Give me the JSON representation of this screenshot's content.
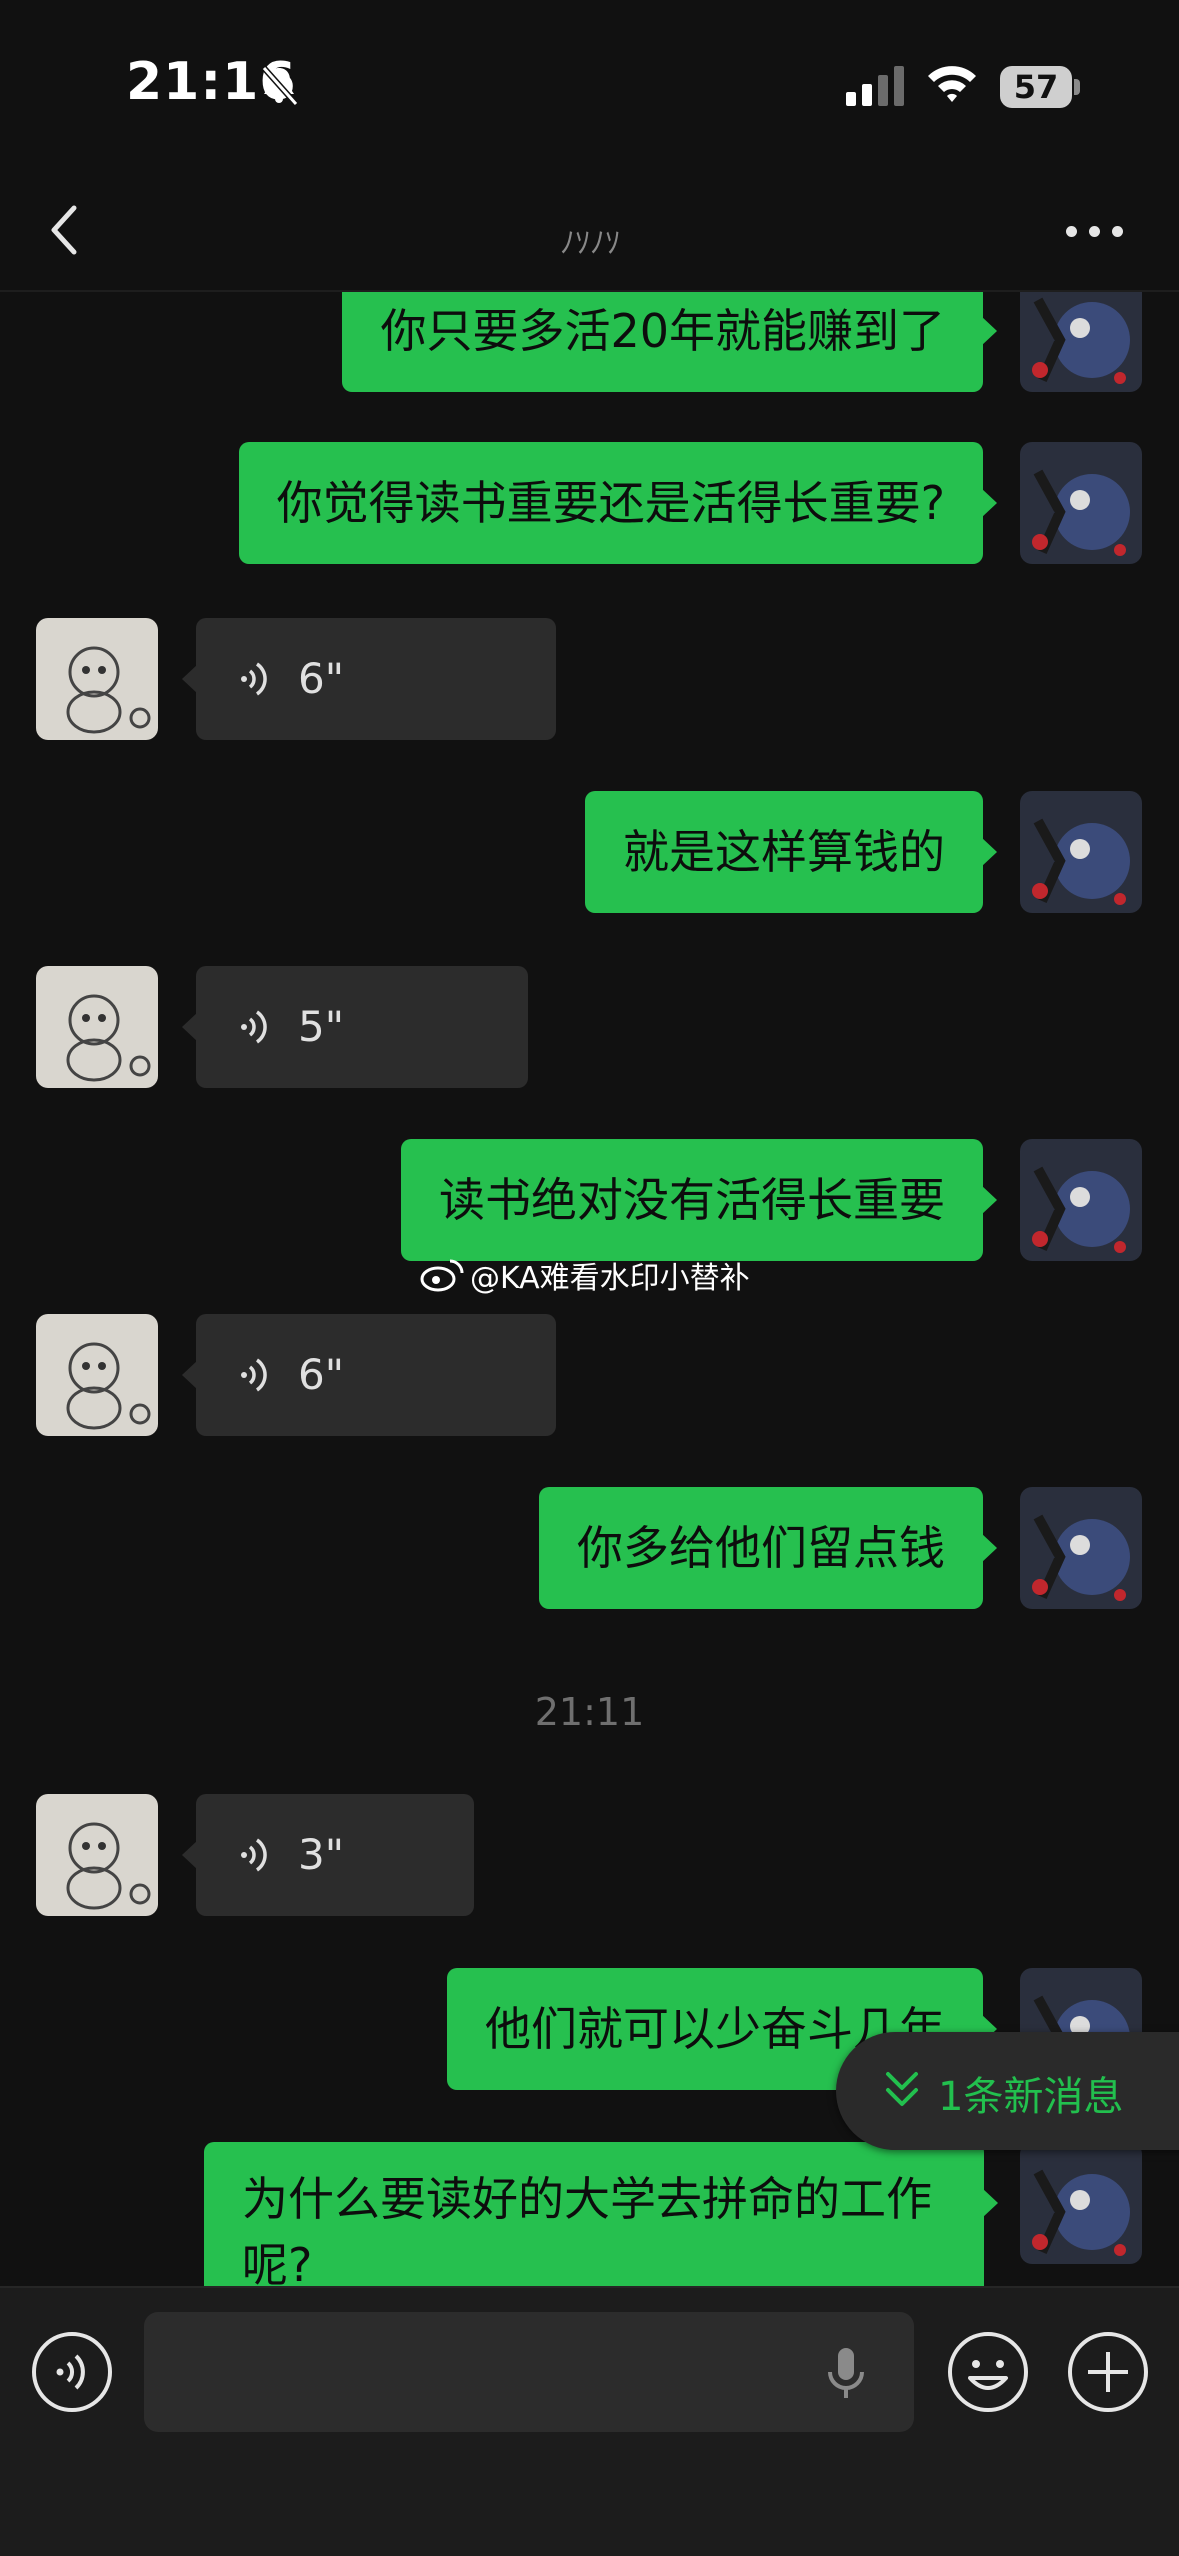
{
  "status_bar": {
    "time": "21:16",
    "battery": "57"
  },
  "nav": {
    "title": "ﾉｿﾉｿ",
    "back_icon": "chevron-left-icon",
    "more_icon": "more-icon"
  },
  "messages": [
    {
      "side": "out",
      "type": "text",
      "text": "你只要多活20年就能赚到了"
    },
    {
      "side": "out",
      "type": "text",
      "text": "你觉得读书重要还是活得长重要?"
    },
    {
      "side": "in",
      "type": "voice",
      "duration": "6\""
    },
    {
      "side": "out",
      "type": "text",
      "text": "就是这样算钱的"
    },
    {
      "side": "in",
      "type": "voice",
      "duration": "5\""
    },
    {
      "side": "out",
      "type": "text",
      "text": "读书绝对没有活得长重要"
    },
    {
      "side": "in",
      "type": "voice",
      "duration": "6\""
    },
    {
      "side": "out",
      "type": "text",
      "text": "你多给他们留点钱"
    },
    {
      "side": "in",
      "type": "voice",
      "duration": "3\""
    },
    {
      "side": "out",
      "type": "text",
      "text": "他们就可以少奋斗几年"
    },
    {
      "side": "out",
      "type": "text",
      "text": "为什么要读好的大学去拼命的工作呢?"
    }
  ],
  "timestamp": "21:11",
  "watermark": "@KA难看水印小替补",
  "new_message_pill": "1条新消息",
  "colors": {
    "outgoing_bubble": "#26c04f",
    "incoming_bubble": "#2c2c2c",
    "background": "#111111",
    "accent_text": "#22c04e"
  }
}
